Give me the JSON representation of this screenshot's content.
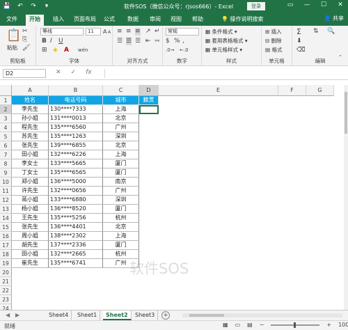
{
  "titlebar": {
    "title": "软件SOS（微信公众号：rjsos666）- Excel",
    "login": "登录",
    "qat": [
      "💾",
      "↶",
      "↷",
      "▾"
    ],
    "controls": [
      "▭",
      "—",
      "☐",
      "✕"
    ]
  },
  "menu": {
    "tabs": [
      "文件",
      "开始",
      "插入",
      "页面布局",
      "公式",
      "数据",
      "审阅",
      "视图",
      "帮助",
      "操作说明搜索"
    ],
    "active": "开始",
    "share": "共享"
  },
  "ribbon": {
    "clipboard": {
      "label": "剪贴板",
      "paste": "粘贴"
    },
    "font": {
      "label": "字体",
      "name": "等线",
      "size": "11",
      "bold": "B",
      "italic": "I",
      "underline": "U",
      "grow": "A",
      "shrink": "A",
      "wen": "wén",
      "fontcolor": "A"
    },
    "alignment": {
      "label": "对齐方式"
    },
    "number": {
      "label": "数字",
      "format": "常规",
      "percent": "%",
      "comma": ","
    },
    "styles": {
      "label": "样式",
      "items": [
        "条件格式",
        "套用表格格式",
        "单元格样式"
      ]
    },
    "cells": {
      "label": "单元格",
      "items": [
        "插入",
        "删除",
        "格式"
      ]
    },
    "editing": {
      "label": "编辑"
    }
  },
  "formulabar": {
    "namebox": "D2",
    "cancel": "✕",
    "enter": "✓",
    "fx": "fx",
    "value": ""
  },
  "grid": {
    "columns": [
      "A",
      "B",
      "C",
      "D",
      "E",
      "F",
      "G"
    ],
    "rows": [
      "1",
      "2",
      "3",
      "4",
      "5",
      "6",
      "7",
      "8",
      "9",
      "10",
      "11",
      "12",
      "13",
      "14",
      "15",
      "16",
      "17",
      "18",
      "19",
      "20",
      "21",
      "22",
      "23",
      "24"
    ],
    "headers": [
      "姓名",
      "电话号码",
      "城市",
      "籍贯"
    ],
    "data": [
      [
        "李先生",
        "130****7333",
        "上海"
      ],
      [
        "孙小姐",
        "131****0013",
        "北京"
      ],
      [
        "程先生",
        "135****6560",
        "广州"
      ],
      [
        "苏先生",
        "135****1263",
        "深圳"
      ],
      [
        "张先生",
        "139****6855",
        "北京"
      ],
      [
        "田小姐",
        "132****6226",
        "上海"
      ],
      [
        "李女士",
        "133****5665",
        "厦门"
      ],
      [
        "丁女士",
        "135****6565",
        "厦门"
      ],
      [
        "郑小姐",
        "136****5000",
        "南京"
      ],
      [
        "许先生",
        "132****0656",
        "广州"
      ],
      [
        "蒋小姐",
        "133****6880",
        "深圳"
      ],
      [
        "杨小姐",
        "136****8520",
        "厦门"
      ],
      [
        "王先生",
        "135****5256",
        "杭州"
      ],
      [
        "张先生",
        "136****4401",
        "北京"
      ],
      [
        "周小姐",
        "138****2302",
        "上海"
      ],
      [
        "胡先生",
        "137****2336",
        "厦门"
      ],
      [
        "田小姐",
        "132****2665",
        "杭州"
      ],
      [
        "崔先生",
        "135****6741",
        "广州"
      ]
    ],
    "watermark": "软件SOS"
  },
  "sheets": {
    "tabs": [
      "Sheet4",
      "Sheet1",
      "Sheet2",
      "Sheet3"
    ],
    "active": "Sheet2",
    "add": "+"
  },
  "status": {
    "ready": "就绪",
    "zoom": "100%",
    "zoom_minus": "−",
    "zoom_plus": "+"
  },
  "colors": {
    "excel_green": "#217346",
    "header_fill": "#0fa5e6"
  }
}
